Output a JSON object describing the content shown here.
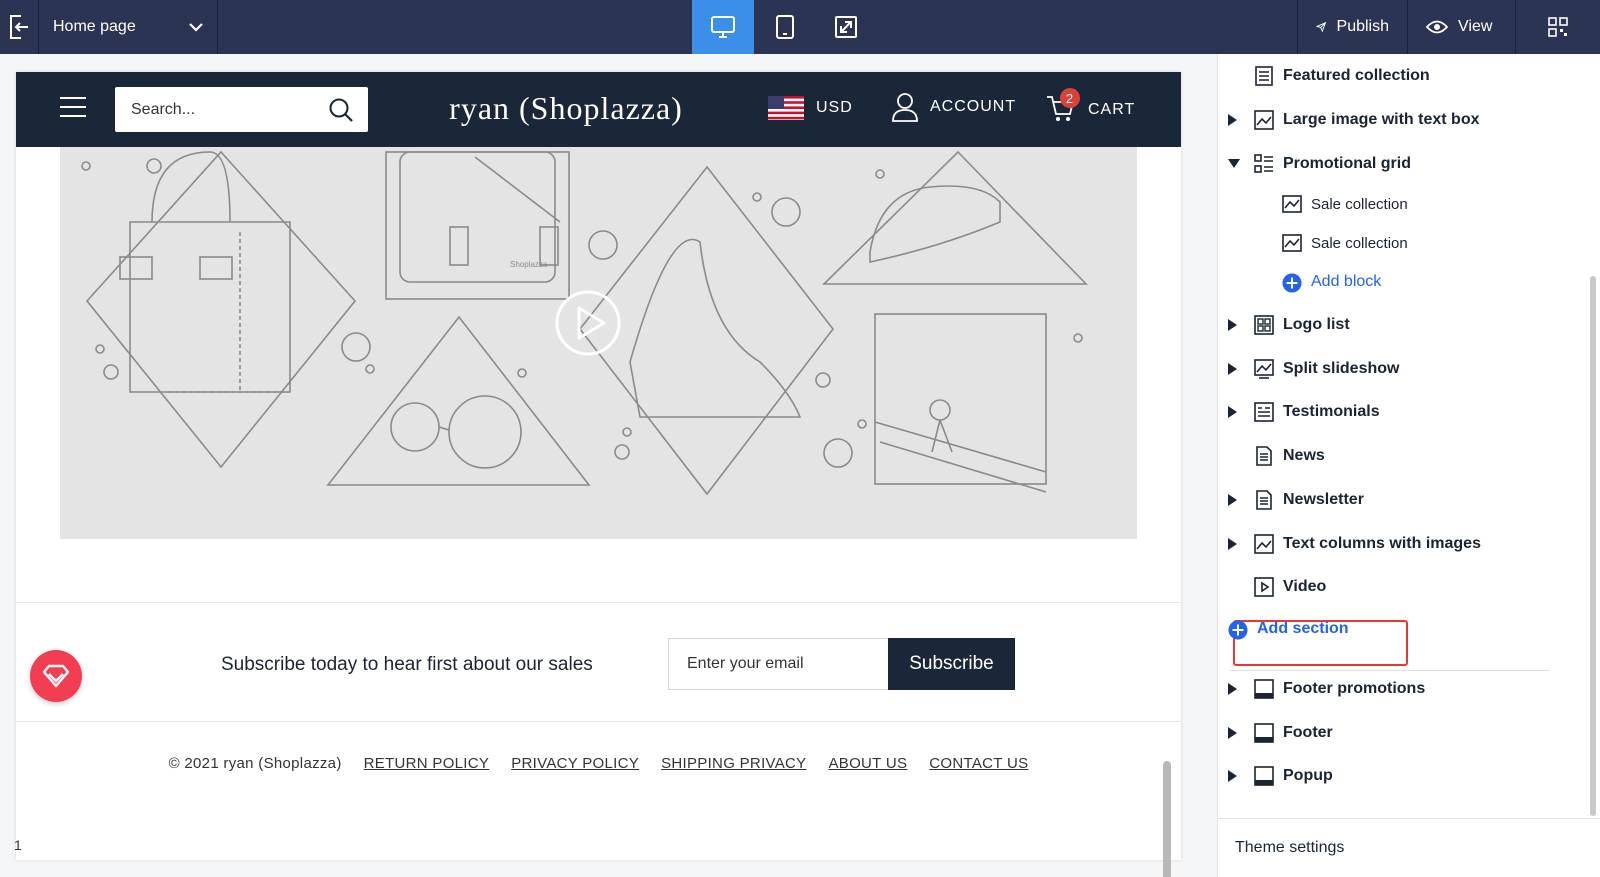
{
  "topbar": {
    "page_select": "Home page",
    "publish": "Publish",
    "view": "View"
  },
  "store": {
    "search_placeholder": "Search...",
    "title": "ryan (Shoplazza)",
    "currency": "USD",
    "account": "ACCOUNT",
    "cart": "CART",
    "cart_count": "2",
    "hero_watermark": "Shoplazza"
  },
  "newsletter": {
    "text": "Subscribe today to hear first about our sales",
    "email_placeholder": "Enter your email",
    "button": "Subscribe"
  },
  "footer": {
    "copyright": "© 2021 ryan (Shoplazza)",
    "links": [
      "RETURN POLICY",
      "PRIVACY POLICY",
      "SHIPPING PRIVACY",
      "ABOUT US",
      "CONTACT US"
    ]
  },
  "page_number": "1",
  "panel": {
    "items": [
      {
        "label": "Featured collection"
      },
      {
        "label": "Large image with text box"
      },
      {
        "label": "Promotional grid"
      },
      {
        "label": "Sale collection"
      },
      {
        "label": "Sale collection"
      },
      {
        "label": "Add block"
      },
      {
        "label": "Logo list"
      },
      {
        "label": "Split slideshow"
      },
      {
        "label": "Testimonials"
      },
      {
        "label": "News"
      },
      {
        "label": "Newsletter"
      },
      {
        "label": "Text columns with images"
      },
      {
        "label": "Video"
      },
      {
        "label": "Add section"
      },
      {
        "label": "Footer promotions"
      },
      {
        "label": "Footer"
      },
      {
        "label": "Popup"
      }
    ],
    "theme_settings": "Theme settings"
  },
  "colors": {
    "topbar_bg": "#2b3452",
    "active_device": "#3b8fe8",
    "store_header": "#1a2738",
    "link_blue": "#2563eb",
    "highlight_red": "#e53935"
  }
}
